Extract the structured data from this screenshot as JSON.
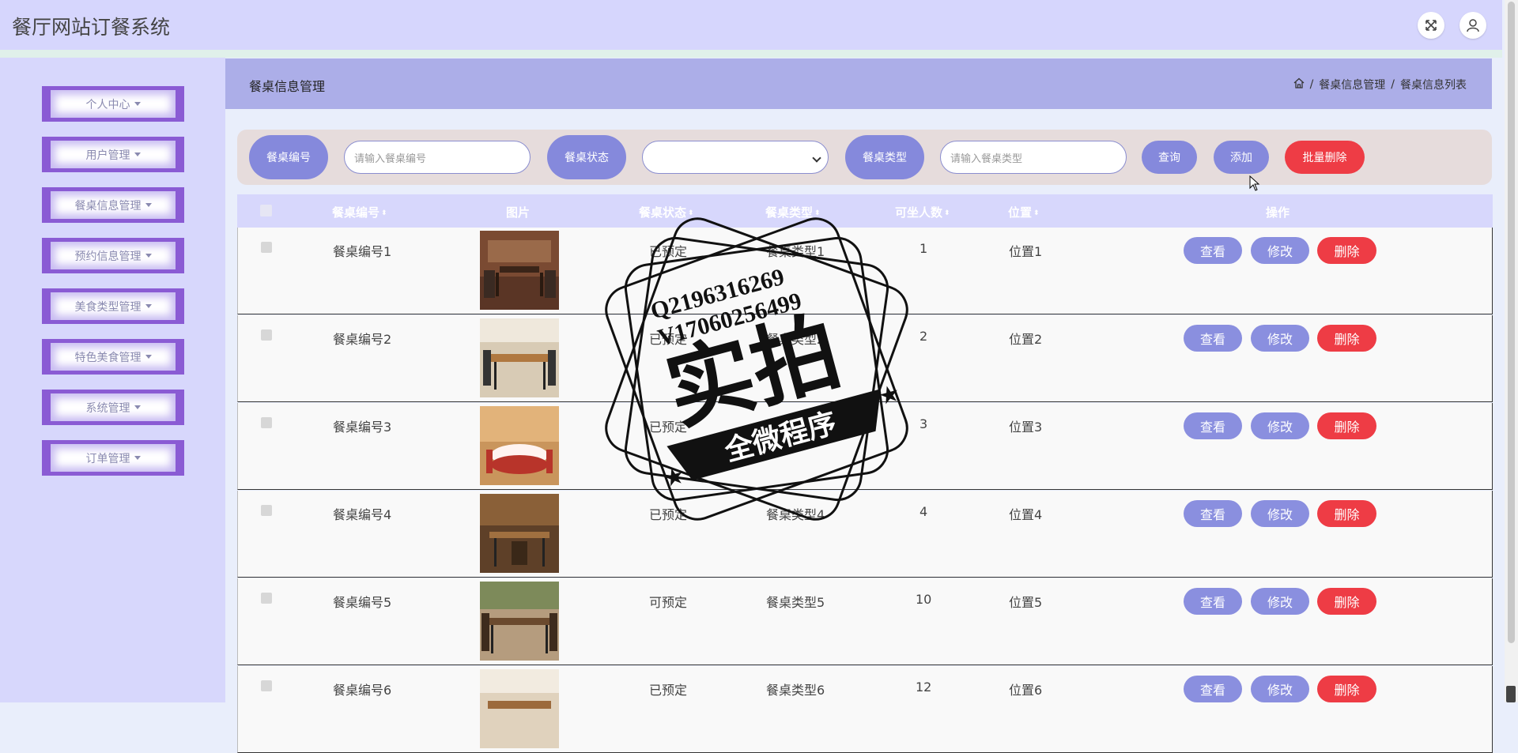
{
  "app": {
    "title": "餐厅网站订餐系统"
  },
  "header_icons": [
    "fullscreen-icon",
    "user-icon"
  ],
  "sidebar": {
    "items": [
      {
        "label": "个人中心"
      },
      {
        "label": "用户管理"
      },
      {
        "label": "餐桌信息管理"
      },
      {
        "label": "预约信息管理"
      },
      {
        "label": "美食类型管理"
      },
      {
        "label": "特色美食管理"
      },
      {
        "label": "系统管理"
      },
      {
        "label": "订单管理"
      }
    ]
  },
  "breadcrumb": {
    "title": "餐桌信息管理",
    "sep1": "/",
    "sep2": "/",
    "path1": "餐桌信息管理",
    "path2": "餐桌信息列表"
  },
  "search": {
    "label_number": "餐桌编号",
    "placeholder_number": "请输入餐桌编号",
    "label_status": "餐桌状态",
    "status_value": "",
    "label_type": "餐桌类型",
    "placeholder_type": "请输入餐桌类型",
    "query_btn": "查询",
    "add_btn": "添加",
    "batch_delete_btn": "批量删除"
  },
  "table": {
    "headers": {
      "number": "餐桌编号",
      "image": "图片",
      "status": "餐桌状态",
      "type": "餐桌类型",
      "seats": "可坐人数",
      "location": "位置",
      "actions": "操作"
    },
    "actions": {
      "view": "查看",
      "edit": "修改",
      "delete": "删除"
    },
    "rows": [
      {
        "number": "餐桌编号1",
        "status": "已预定",
        "type": "餐桌类型1",
        "seats": "1",
        "location": "位置1"
      },
      {
        "number": "餐桌编号2",
        "status": "已预定",
        "type": "餐桌类型2",
        "seats": "2",
        "location": "位置2"
      },
      {
        "number": "餐桌编号3",
        "status": "已预定",
        "type": "餐桌类型3",
        "seats": "3",
        "location": "位置3"
      },
      {
        "number": "餐桌编号4",
        "status": "已预定",
        "type": "餐桌类型4",
        "seats": "4",
        "location": "位置4"
      },
      {
        "number": "餐桌编号5",
        "status": "可预定",
        "type": "餐桌类型5",
        "seats": "10",
        "location": "位置5"
      },
      {
        "number": "餐桌编号6",
        "status": "已预定",
        "type": "餐桌类型6",
        "seats": "12",
        "location": "位置6"
      }
    ]
  },
  "watermark": {
    "line1": "Q2196316269",
    "line2": "V17060256499",
    "big": "实拍",
    "banner": "全微程序"
  },
  "colors": {
    "topbar": "#d6d6fd",
    "sidebar": "#d7d7fc",
    "accent": "#8589dc",
    "danger": "#ee3c45",
    "menu_border": "#8a5bd4"
  }
}
